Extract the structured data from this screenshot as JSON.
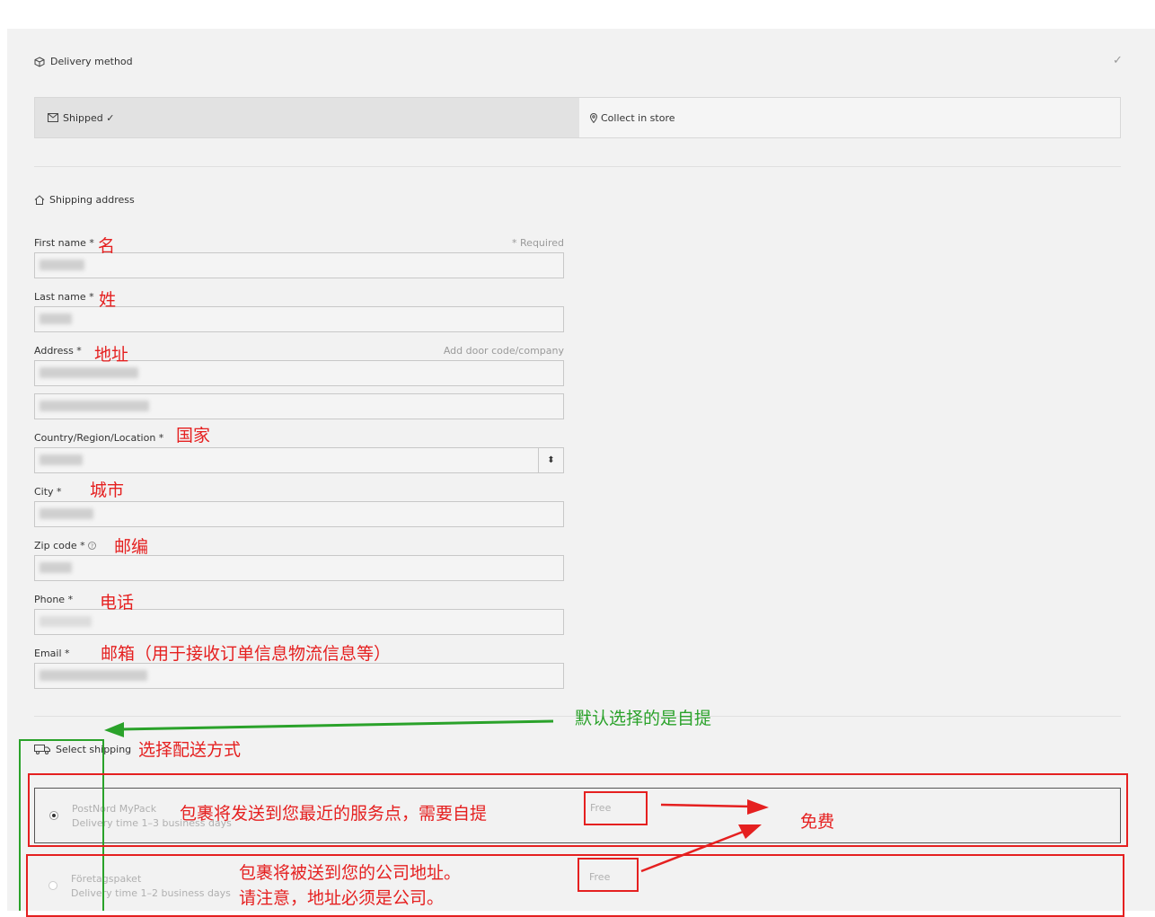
{
  "delivery_method": {
    "title": "Delivery method",
    "check": "✓",
    "options": [
      {
        "label": "Shipped ✓",
        "selected": true
      },
      {
        "label": "Collect in store",
        "selected": false
      }
    ]
  },
  "shipping_address": {
    "title": "Shipping address",
    "required_note": "* Required",
    "address_hint": "Add door code/company",
    "fields": {
      "first_name": "First name *",
      "last_name": "Last name *",
      "address": "Address *",
      "country": "Country/Region/Location *",
      "city": "City *",
      "zip": "Zip code *",
      "phone": "Phone *",
      "email": "Email *"
    }
  },
  "select_shipping": {
    "title": "Select shipping",
    "options": [
      {
        "name": "PostNord MyPack",
        "time": "Delivery time 1–3 business days",
        "price": "Free",
        "selected": true
      },
      {
        "name": "Företagspaket",
        "time": "Delivery time 1–2 business days",
        "price": "Free",
        "selected": false
      }
    ]
  },
  "annotations": {
    "first_name": "名",
    "last_name": "姓",
    "address": "地址",
    "country": "国家",
    "city": "城市",
    "zip": "邮编",
    "phone": "电话",
    "email": "邮箱（用于接收订单信息物流信息等）",
    "default_pickup": "默认选择的是自提",
    "select_shipping": "选择配送方式",
    "option1_note": "包裹将发送到您最近的服务点，需要自提",
    "free": "免费",
    "option2_note_line1": "包裹将被送到您的公司地址。",
    "option2_note_line2": "请注意，地址必须是公司。"
  },
  "colors": {
    "annotation_red": "#e52020",
    "annotation_green": "#2aa22a"
  }
}
